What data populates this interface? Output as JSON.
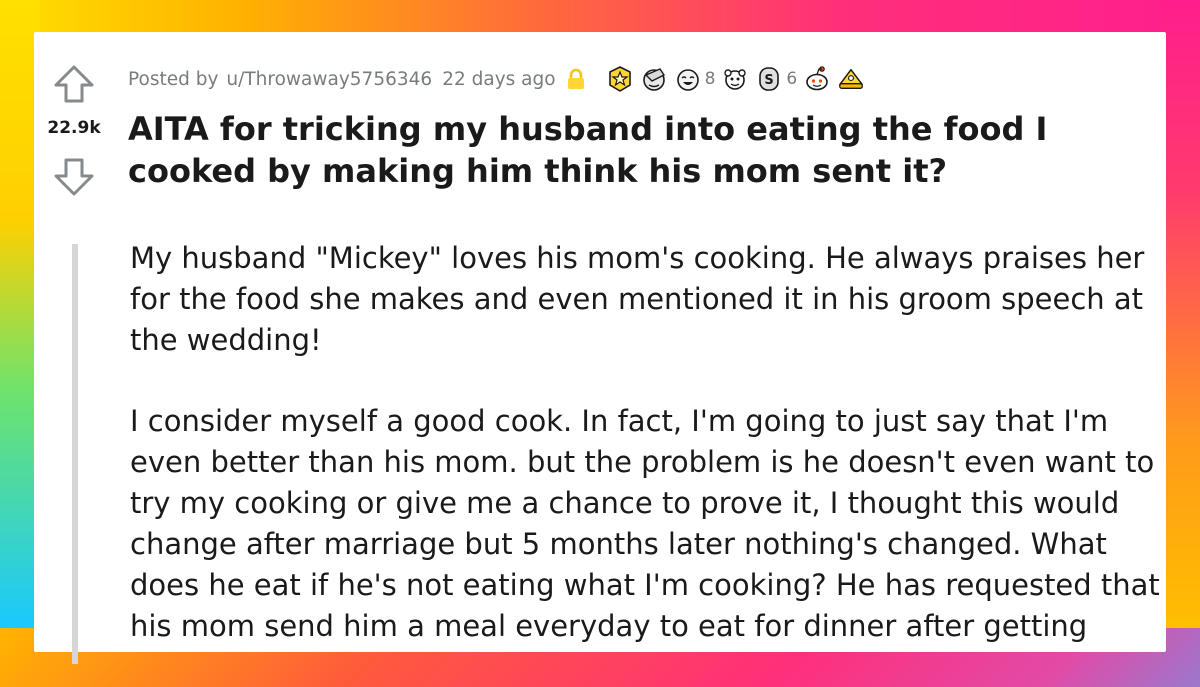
{
  "post": {
    "posted_by_prefix": "Posted by",
    "author": "u/Throwaway5756346",
    "age": "22 days ago",
    "score": "22.9k",
    "title": "AITA for tricking my husband into eating the food I cooked by making him think his mom sent it?",
    "paragraphs": [
      "My husband \"Mickey\" loves his mom's cooking. He always praises her for the food she makes and even mentioned it in his groom speech at the wedding!",
      "I consider myself a good cook. In fact, I'm going to just say that I'm even better than his mom. but the problem is he doesn't even want to try my cooking or give me a chance to prove it, I thought this would change after marriage but 5 months later nothing's changed. What does he eat if he's not eating what I'm cooking? He has requested that his mom send him a meal everyday to eat for dinner after getting"
    ]
  },
  "awards": [
    {
      "icon": "star-medal-award-icon",
      "count": ""
    },
    {
      "icon": "facepalm-award-icon",
      "count": ""
    },
    {
      "icon": "laughing-face-award-icon",
      "count": "8"
    },
    {
      "icon": "wholesome-award-icon",
      "count": ""
    },
    {
      "icon": "silver-coin-award-icon",
      "count": "6"
    },
    {
      "icon": "snoo-award-icon",
      "count": ""
    },
    {
      "icon": "gold-hat-award-icon",
      "count": ""
    }
  ],
  "colors": {
    "lock": "#ffd635",
    "text": "#1a1a1b",
    "meta": "#787c7e"
  }
}
